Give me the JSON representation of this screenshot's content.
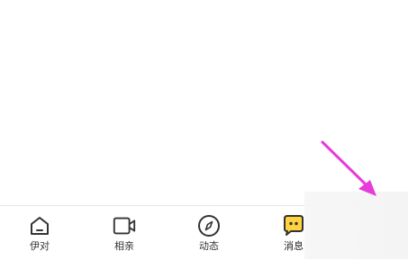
{
  "tabbar": {
    "tabs": [
      {
        "id": "yidui",
        "label": "伊对",
        "icon": "home-icon"
      },
      {
        "id": "xiangqin",
        "label": "相亲",
        "icon": "video-camera-icon"
      },
      {
        "id": "dongtai",
        "label": "动态",
        "icon": "compass-icon"
      },
      {
        "id": "xiaoxi",
        "label": "消息",
        "icon": "chat-bubble-icon",
        "active": true
      }
    ]
  },
  "colors": {
    "active_icon": "#FFD23F",
    "arrow": "#E83BD9",
    "icon_stroke": "#333333"
  },
  "annotation": {
    "icon": "arrow-pointer-icon"
  }
}
